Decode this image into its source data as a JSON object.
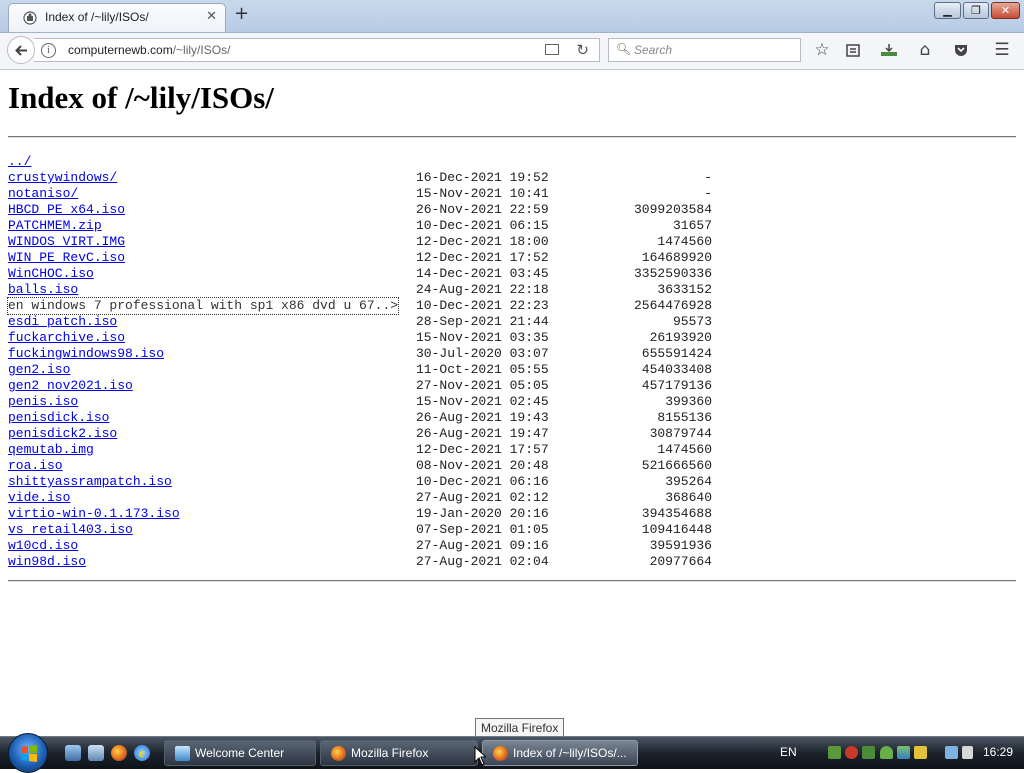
{
  "browser": {
    "tab_title": "Index of /~lily/ISOs/",
    "url_domain": "computernewb.com",
    "url_path": "/~lily/ISOs/",
    "search_placeholder": "Search"
  },
  "page": {
    "heading": "Index of /~lily/ISOs/",
    "entries": [
      {
        "name": "../",
        "date": "",
        "size": ""
      },
      {
        "name": "crustywindows/",
        "date": "16-Dec-2021 19:52",
        "size": "-"
      },
      {
        "name": "notaniso/",
        "date": "15-Nov-2021 10:41",
        "size": "-"
      },
      {
        "name": "HBCD PE x64.iso",
        "date": "26-Nov-2021 22:59",
        "size": "3099203584"
      },
      {
        "name": "PATCHMEM.zip",
        "date": "10-Dec-2021 06:15",
        "size": "31657"
      },
      {
        "name": "WINDOS VIRT.IMG",
        "date": "12-Dec-2021 18:00",
        "size": "1474560"
      },
      {
        "name": "WIN PE RevC.iso",
        "date": "12-Dec-2021 17:52",
        "size": "164689920"
      },
      {
        "name": "WinCHOC.iso",
        "date": "14-Dec-2021 03:45",
        "size": "3352590336"
      },
      {
        "name": "balls.iso",
        "date": "24-Aug-2021 22:18",
        "size": "3633152"
      },
      {
        "name": "en windows 7 professional with sp1 x86 dvd u 67..>",
        "date": "10-Dec-2021 22:23",
        "size": "2564476928"
      },
      {
        "name": "esdi patch.iso",
        "date": "28-Sep-2021 21:44",
        "size": "95573"
      },
      {
        "name": "fuckarchive.iso",
        "date": "15-Nov-2021 03:35",
        "size": "26193920"
      },
      {
        "name": "fuckingwindows98.iso",
        "date": "30-Jul-2020 03:07",
        "size": "655591424"
      },
      {
        "name": "gen2.iso",
        "date": "11-Oct-2021 05:55",
        "size": "454033408"
      },
      {
        "name": "gen2 nov2021.iso",
        "date": "27-Nov-2021 05:05",
        "size": "457179136"
      },
      {
        "name": "penis.iso",
        "date": "15-Nov-2021 02:45",
        "size": "399360"
      },
      {
        "name": "penisdick.iso",
        "date": "26-Aug-2021 19:43",
        "size": "8155136"
      },
      {
        "name": "penisdick2.iso",
        "date": "26-Aug-2021 19:47",
        "size": "30879744"
      },
      {
        "name": "qemutab.img",
        "date": "12-Dec-2021 17:57",
        "size": "1474560"
      },
      {
        "name": "roa.iso",
        "date": "08-Nov-2021 20:48",
        "size": "521666560"
      },
      {
        "name": "shittyassrampatch.iso",
        "date": "10-Dec-2021 06:16",
        "size": "395264"
      },
      {
        "name": "vide.iso",
        "date": "27-Aug-2021 02:12",
        "size": "368640"
      },
      {
        "name": "virtio-win-0.1.173.iso",
        "date": "19-Jan-2020 20:16",
        "size": "394354688"
      },
      {
        "name": "vs retail403.iso",
        "date": "07-Sep-2021 01:05",
        "size": "109416448"
      },
      {
        "name": "w10cd.iso",
        "date": "27-Aug-2021 09:16",
        "size": "39591936"
      },
      {
        "name": "win98d.iso",
        "date": "27-Aug-2021 02:04",
        "size": "20977664"
      }
    ]
  },
  "tooltip": "Mozilla Firefox",
  "taskbar": {
    "buttons": [
      {
        "label": "Welcome Center"
      },
      {
        "label": "Mozilla Firefox"
      },
      {
        "label": "Index of /~lily/ISOs/..."
      }
    ],
    "language": "EN",
    "clock": "16:29"
  }
}
